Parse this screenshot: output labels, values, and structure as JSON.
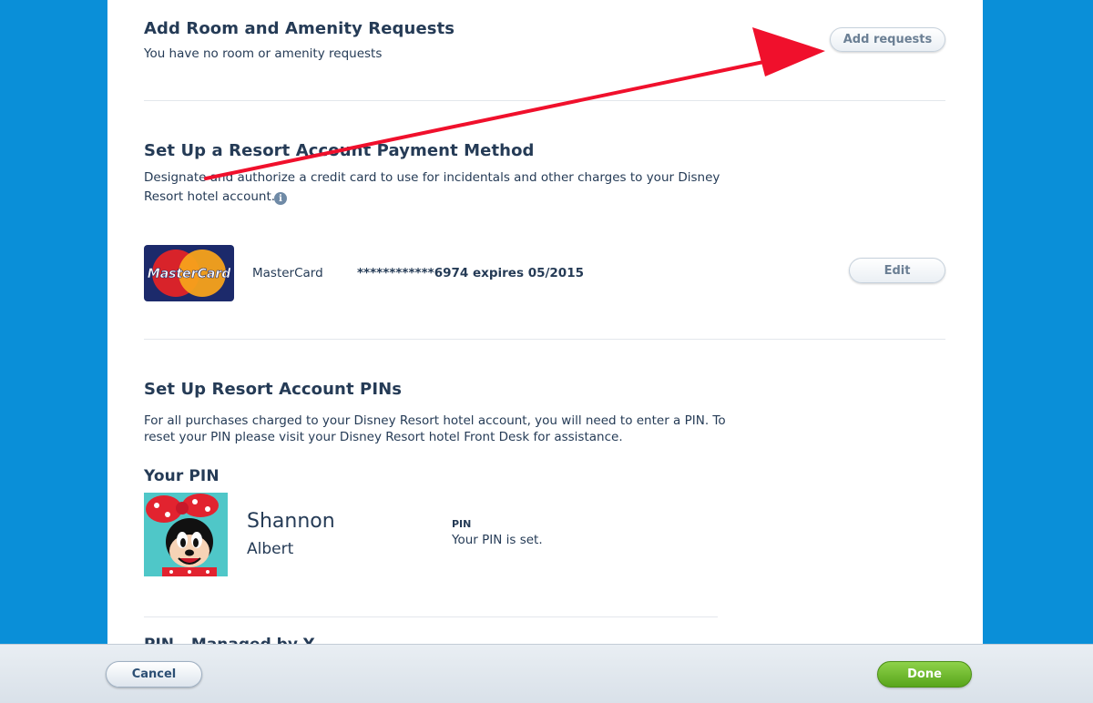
{
  "amenity": {
    "title": "Add Room and Amenity Requests",
    "subtitle": "You have no room or amenity requests",
    "button": "Add requests"
  },
  "payment": {
    "title": "Set Up a Resort Account Payment Method",
    "desc_line1": "Designate and authorize a credit card to use for incidentals and other charges to your Disney",
    "desc_line2": "Resort hotel account.",
    "info_glyph": "i",
    "card_logo_text": "MasterCard",
    "card_name": "MasterCard",
    "card_number": "************6974 expires 05/2015",
    "edit_button": "Edit"
  },
  "pins": {
    "title": "Set Up Resort Account PINs",
    "desc_line1": "For all purchases charged to your Disney Resort hotel account, you will need to enter a PIN. To",
    "desc_line2": "reset your PIN please visit your Disney Resort hotel Front Desk for assistance.",
    "your_pin_heading": "Your PIN",
    "first_name": "Shannon",
    "last_name": "Albert",
    "pin_label": "PIN",
    "pin_status": "Your PIN is set.",
    "next_heading": "PIN - Managed by Y..."
  },
  "footer": {
    "cancel": "Cancel",
    "done": "Done"
  },
  "colors": {
    "background": "#0a8fd8",
    "heading": "#253b56",
    "done_green": "#6bbd2c",
    "annotation_arrow": "#f0102c"
  },
  "icons": [
    "info-icon",
    "mastercard-logo",
    "minnie-mouse-avatar",
    "annotation-arrow"
  ]
}
